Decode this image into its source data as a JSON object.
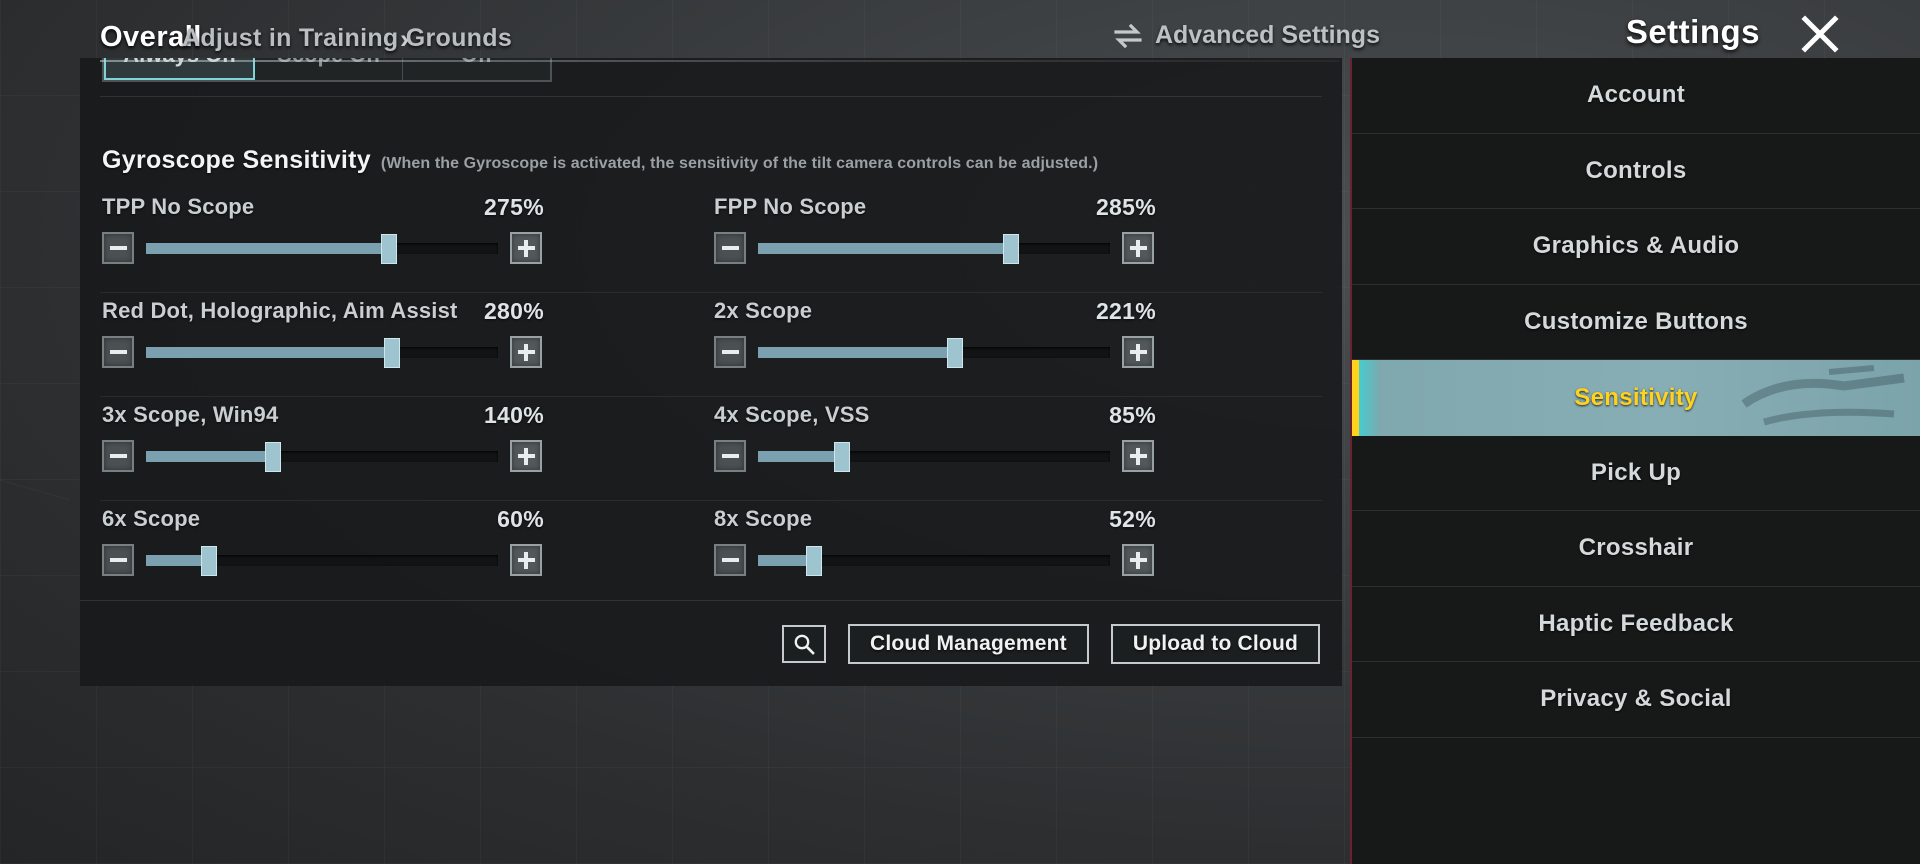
{
  "header": {
    "tab_overall": "Overall",
    "tab_adjust": "Adjust in Training Grounds",
    "chevron": "›",
    "advanced_settings": "Advanced Settings",
    "title": "Settings",
    "close": "✕"
  },
  "segmented": {
    "options": [
      "Always On",
      "Scope On",
      "Off"
    ],
    "selected": "Always On"
  },
  "section": {
    "title": "Gyroscope Sensitivity",
    "note": "(When the Gyroscope is activated, the sensitivity of the tilt camera controls can be adjusted.)"
  },
  "sliders": [
    {
      "label": "TPP No Scope",
      "value": "275%",
      "percent": 69
    },
    {
      "label": "FPP No Scope",
      "value": "285%",
      "percent": 72
    },
    {
      "label": "Red Dot, Holographic, Aim Assist",
      "value": "280%",
      "percent": 70
    },
    {
      "label": "2x Scope",
      "value": "221%",
      "percent": 56
    },
    {
      "label": "3x Scope, Win94",
      "value": "140%",
      "percent": 36
    },
    {
      "label": "4x Scope, VSS",
      "value": "85%",
      "percent": 24
    },
    {
      "label": "6x Scope",
      "value": "60%",
      "percent": 18
    },
    {
      "label": "8x Scope",
      "value": "52%",
      "percent": 16
    }
  ],
  "actions": {
    "search_icon": "search-icon",
    "cloud_management": "Cloud Management",
    "upload_to_cloud": "Upload to Cloud"
  },
  "sidebar": {
    "items": [
      {
        "label": "Account",
        "active": false
      },
      {
        "label": "Controls",
        "active": false
      },
      {
        "label": "Graphics & Audio",
        "active": false
      },
      {
        "label": "Customize Buttons",
        "active": false
      },
      {
        "label": "Sensitivity",
        "active": true
      },
      {
        "label": "Pick Up",
        "active": false
      },
      {
        "label": "Crosshair",
        "active": false
      },
      {
        "label": "Haptic Feedback",
        "active": false
      },
      {
        "label": "Privacy & Social",
        "active": false
      }
    ]
  },
  "colors": {
    "accent_yellow": "#ffd21e",
    "slider_fill": "#7ba0b0",
    "slider_thumb": "#9ec4cf",
    "sidebar_border": "#6b2230",
    "panel_bg": "#181a1b"
  }
}
